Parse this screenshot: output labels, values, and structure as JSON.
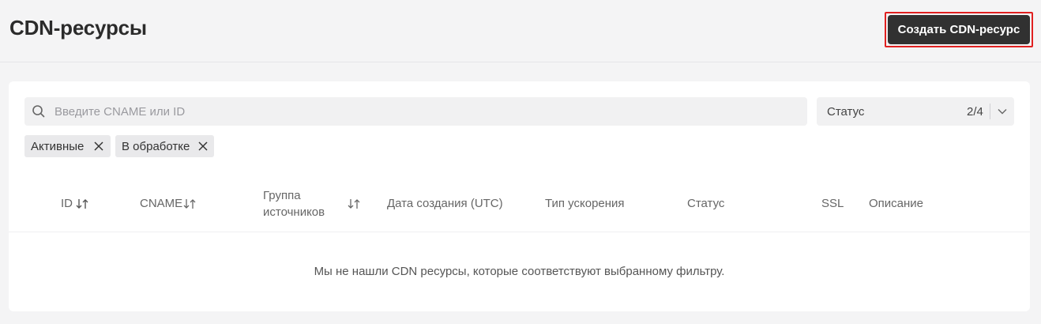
{
  "header": {
    "title": "CDN-ресурсы",
    "create_button": "Создать CDN-ресурс"
  },
  "filters": {
    "search": {
      "placeholder": "Введите CNAME или ID",
      "value": ""
    },
    "status": {
      "label": "Статус",
      "count": "2/4"
    },
    "chips": [
      {
        "label": "Активные"
      },
      {
        "label": "В обработке"
      }
    ]
  },
  "table": {
    "columns": {
      "id": "ID",
      "cname": "CNAME",
      "group_line1": "Группа",
      "group_line2": "источников",
      "created": "Дата создания (UTC)",
      "accel": "Тип ускорения",
      "status": "Статус",
      "ssl": "SSL",
      "description": "Описание"
    },
    "empty_message": "Мы не нашли CDN ресурсы, которые соответствуют выбранному фильтру."
  },
  "icons": {
    "search": "search-icon",
    "chevron": "chevron-down-icon",
    "chip_close": "close-icon",
    "sort": "sort-icon"
  },
  "colors": {
    "primary_button": "#313131",
    "highlight_border": "#e02020",
    "page_bg": "#f4f4f5",
    "input_bg": "#f1f1f2",
    "chip_bg": "#e9e9eb"
  }
}
